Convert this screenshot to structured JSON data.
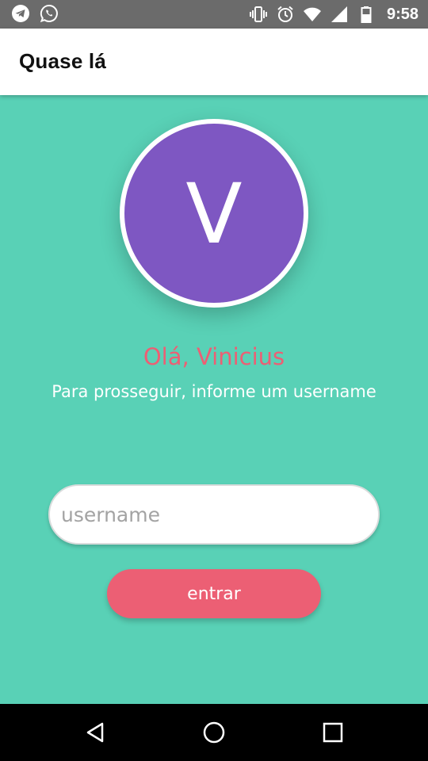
{
  "status_bar": {
    "time": "9:58",
    "left_icons": [
      "telegram-icon",
      "whatsapp-icon"
    ],
    "right_icons": [
      "vibrate-icon",
      "alarm-icon",
      "wifi-icon",
      "signal-icon",
      "battery-icon"
    ]
  },
  "app_bar": {
    "title": "Quase lá"
  },
  "profile": {
    "initial": "V",
    "avatar_color": "#7e57c2"
  },
  "greeting": "Olá, Vinicius",
  "instruction": "Para prosseguir, informe um username",
  "form": {
    "username_value": "",
    "username_placeholder": "username",
    "submit_label": "entrar"
  },
  "nav_bar": {
    "buttons": [
      "back-icon",
      "home-icon",
      "recents-icon"
    ]
  },
  "colors": {
    "background": "#59d1b6",
    "accent": "#ec5f74",
    "avatar": "#7e57c2",
    "status_bar": "#6b6b6b",
    "nav_bar": "#000000"
  }
}
